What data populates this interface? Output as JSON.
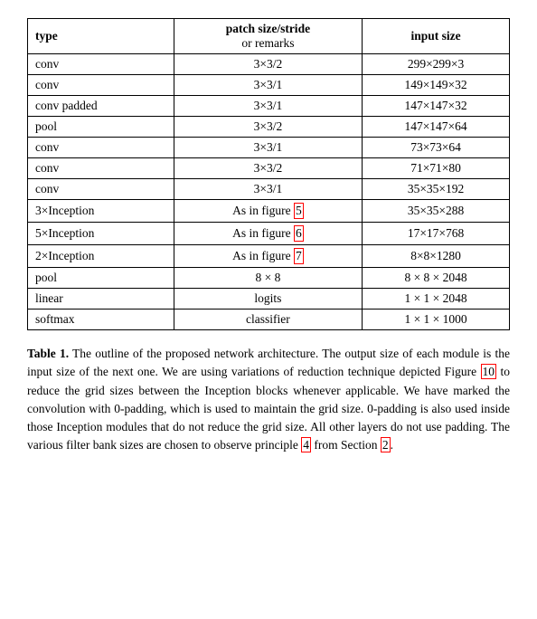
{
  "table": {
    "headers": {
      "col1": "type",
      "col2_line1": "patch size/stride",
      "col2_line2": "or remarks",
      "col3": "input size"
    },
    "rows": [
      {
        "type": "conv",
        "patch": "3×3/2",
        "input": "299×299×3"
      },
      {
        "type": "conv",
        "patch": "3×3/1",
        "input": "149×149×32"
      },
      {
        "type": "conv padded",
        "patch": "3×3/1",
        "input": "147×147×32"
      },
      {
        "type": "pool",
        "patch": "3×3/2",
        "input": "147×147×64"
      },
      {
        "type": "conv",
        "patch": "3×3/1",
        "input": "73×73×64"
      },
      {
        "type": "conv",
        "patch": "3×3/2",
        "input": "71×71×80"
      },
      {
        "type": "conv",
        "patch": "3×3/1",
        "input": "35×35×192"
      },
      {
        "type": "3×Inception",
        "patch": "As in figure 5",
        "patch_link": "5",
        "input": "35×35×288"
      },
      {
        "type": "5×Inception",
        "patch": "As in figure 6",
        "patch_link": "6",
        "input": "17×17×768"
      },
      {
        "type": "2×Inception",
        "patch": "As in figure 7",
        "patch_link": "7",
        "input": "8×8×1280"
      },
      {
        "type": "pool",
        "patch": "8 × 8",
        "input": "8 × 8 × 2048"
      },
      {
        "type": "linear",
        "patch": "logits",
        "input": "1 × 1 × 2048"
      },
      {
        "type": "softmax",
        "patch": "classifier",
        "input": "1 × 1 × 1000"
      }
    ]
  },
  "caption": {
    "label": "Table 1.",
    "text": " The outline of the proposed network architecture. The output size of each module is the input size of the next one. We are using variations of reduction technique depicted Figure ",
    "link1": "10",
    "text2": " to reduce the grid sizes between the Inception blocks whenever applicable. We have marked the convolution with 0-padding, which is used to maintain the grid size. 0-padding is also used inside those Inception modules that do not reduce the grid size. All other layers do not use padding. The various filter bank sizes are chosen to observe principle ",
    "link2": "4",
    "text3": " from Section ",
    "link3": "2",
    "text4": "."
  }
}
